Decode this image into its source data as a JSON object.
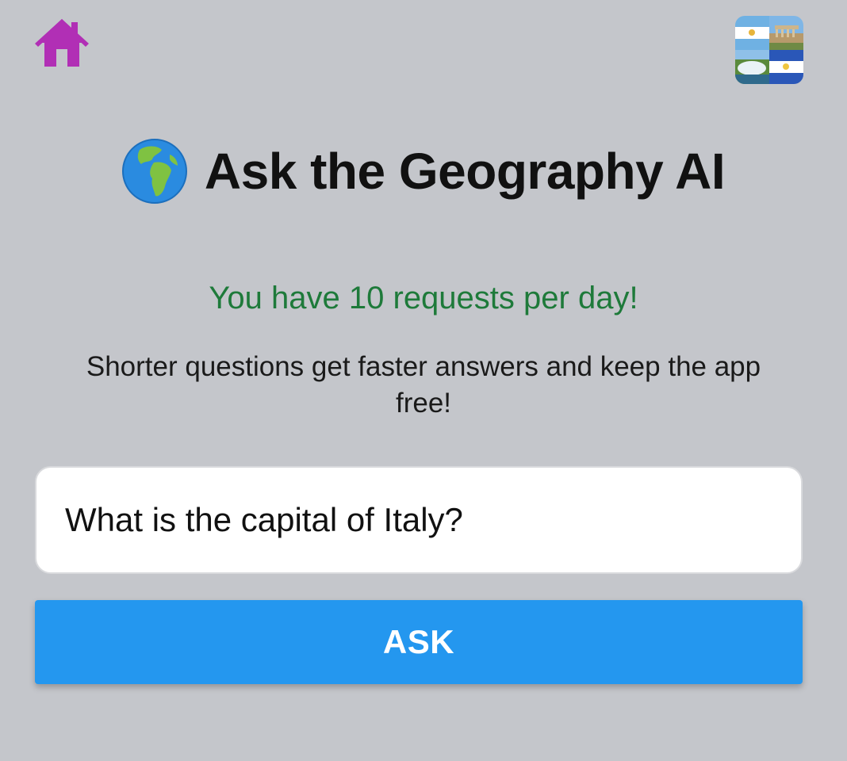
{
  "header": {
    "home_icon": "home-icon",
    "logo_icon": "flags-collage-logo"
  },
  "title": {
    "icon": "globe-europe-africa-icon",
    "text": "Ask the Geography AI"
  },
  "quota_text": "You have 10 requests per day!",
  "hint_text": "Shorter questions get faster answers and keep the app free!",
  "question_input": {
    "value": "What is the capital of Italy?"
  },
  "ask_button": {
    "label": "ASK"
  },
  "colors": {
    "background": "#c4c6cb",
    "home_icon": "#b12fb5",
    "quota_text": "#1e7a3a",
    "ask_button": "#2497ef"
  }
}
